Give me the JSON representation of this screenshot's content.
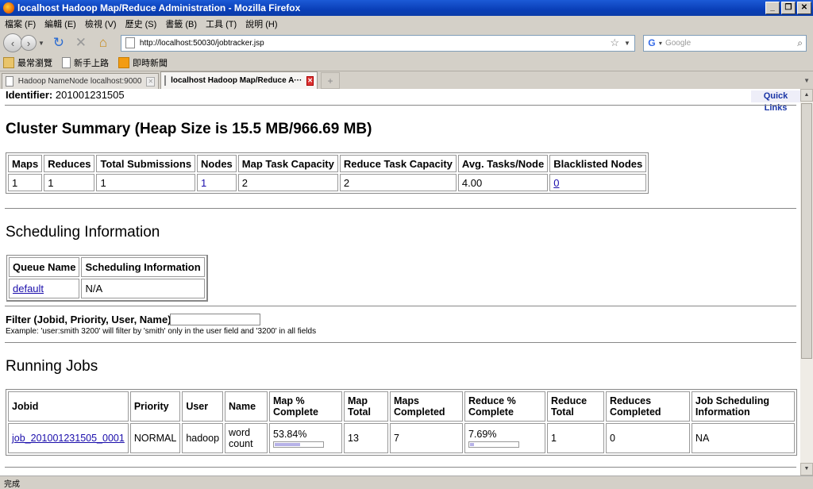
{
  "window": {
    "title": "localhost Hadoop Map/Reduce Administration - Mozilla Firefox",
    "min": "_",
    "max": "❐",
    "close": "✕"
  },
  "menu": [
    "檔案 (F)",
    "編輯 (E)",
    "檢視 (V)",
    "歷史 (S)",
    "書籤 (B)",
    "工具 (T)",
    "說明 (H)"
  ],
  "nav": {
    "url": "http://localhost:50030/jobtracker.jsp",
    "search_placeholder": "Google"
  },
  "bookmarks": [
    "最常瀏覽",
    "新手上路",
    "即時新聞"
  ],
  "tabs": [
    {
      "label": "Hadoop NameNode localhost:9000",
      "active": false
    },
    {
      "label": "localhost Hadoop Map/Reduce A···",
      "active": true
    }
  ],
  "page": {
    "identifier_label": "Identifier:",
    "identifier_value": "201001231505",
    "quick_links": "Quick Links",
    "cluster_title": "Cluster Summary (Heap Size is 15.5 MB/966.69 MB)",
    "cluster_headers": [
      "Maps",
      "Reduces",
      "Total Submissions",
      "Nodes",
      "Map Task Capacity",
      "Reduce Task Capacity",
      "Avg. Tasks/Node",
      "Blacklisted Nodes"
    ],
    "cluster_values": [
      "1",
      "1",
      "1",
      "1",
      "2",
      "2",
      "4.00",
      "0"
    ],
    "sched_title": "Scheduling Information",
    "sched_headers": [
      "Queue Name",
      "Scheduling Information"
    ],
    "sched_values": [
      "default",
      "N/A"
    ],
    "filter_label": "Filter (Jobid, Priority, User, Name)",
    "filter_value": "",
    "filter_example": "Example: 'user:smith 3200' will filter by 'smith' only in the user field and '3200' in all fields",
    "running_title": "Running Jobs",
    "running_headers": [
      "Jobid",
      "Priority",
      "User",
      "Name",
      "Map % Complete",
      "Map Total",
      "Maps Completed",
      "Reduce % Complete",
      "Reduce Total",
      "Reduces Completed",
      "Job Scheduling Information"
    ],
    "running_row": {
      "jobid": "job_201001231505_0001",
      "priority": "NORMAL",
      "user": "hadoop",
      "name": "word count",
      "map_pct": "53.84%",
      "map_pct_value": 53.84,
      "map_total": "13",
      "maps_completed": "7",
      "reduce_pct": "7.69%",
      "reduce_pct_value": 7.69,
      "reduce_total": "1",
      "reduces_completed": "0",
      "sched_info": "NA"
    }
  },
  "status": "完成"
}
